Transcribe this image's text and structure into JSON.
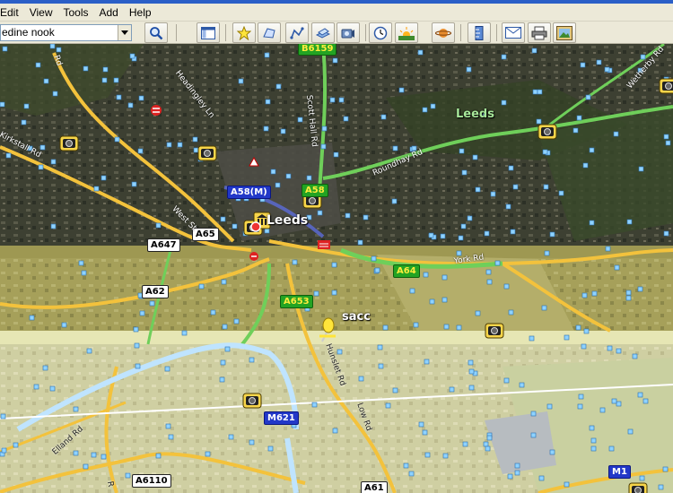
{
  "menu": [
    "Edit",
    "View",
    "Tools",
    "Add",
    "Help"
  ],
  "search": {
    "value": "edine nook"
  },
  "toolbar_icons": [
    "search-icon",
    "sidebar-icon",
    "placemark-icon",
    "polygon-icon",
    "path-icon",
    "overlay-icon",
    "tour-icon",
    "historical-imagery-icon",
    "sunlight-icon",
    "planets-icon",
    "ruler-icon",
    "email-icon",
    "print-icon",
    "image-icon"
  ],
  "map": {
    "places": {
      "leeds_city": "Leeds",
      "leeds_region": "Leeds",
      "sacc": "sacc"
    },
    "roads": {
      "b6159": "B6159",
      "a58m": "A58(M)",
      "a58": "A58",
      "a65": "A65",
      "a647": "A647",
      "a64": "A64",
      "a62": "A62",
      "a653": "A653",
      "m621": "M621",
      "a6110": "A6110",
      "a61": "A61",
      "m1": "M1"
    },
    "streets": {
      "headingley": "Headingley Ln",
      "scott_hall": "Scott Hall Rd",
      "wetherby": "Wetherby Rd",
      "roundhay": "Roundhay Rd",
      "kirkstall": "Kirkstall Rd",
      "west_st": "West St",
      "york_rd": "York Rd",
      "elland": "Elland Rd",
      "low_rd": "Low Rd",
      "hunslet": "Hunslet Rd",
      "a_rd": "Rd",
      "r_bottom": "R"
    },
    "colors": {
      "major_road": "#f3c23c",
      "secondary_road": "#6fcf5a",
      "motorway": "#bfe4ff",
      "motorway_label": "#2238c8"
    }
  }
}
